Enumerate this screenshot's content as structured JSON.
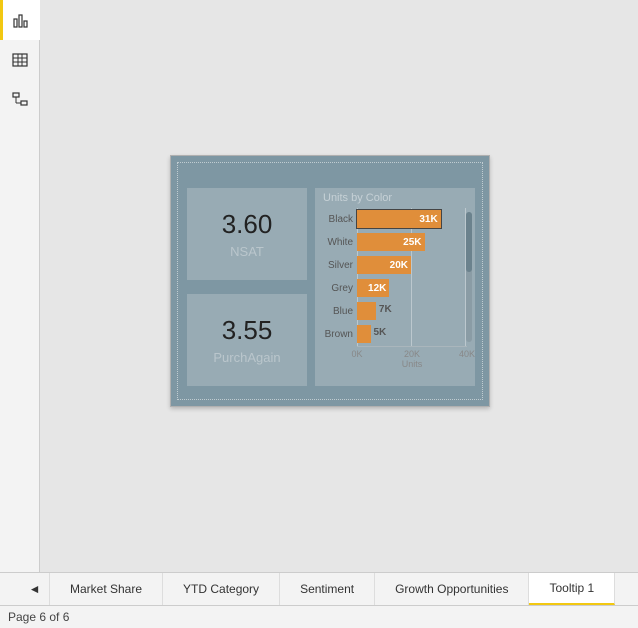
{
  "rail": {
    "report": true,
    "data": false,
    "model": false
  },
  "cards": [
    {
      "value": "3.60",
      "label": "NSAT"
    },
    {
      "value": "3.55",
      "label": "PurchAgain"
    }
  ],
  "chart_data": {
    "type": "bar",
    "title": "Units by Color",
    "xlabel": "Units",
    "categories": [
      "Black",
      "White",
      "Silver",
      "Grey",
      "Blue",
      "Brown"
    ],
    "values": [
      31000,
      25000,
      20000,
      12000,
      7000,
      5000
    ],
    "value_labels": [
      "31K",
      "25K",
      "20K",
      "12K",
      "7K",
      "5K"
    ],
    "xlim": [
      0,
      40000
    ],
    "ticks": [
      0,
      20000,
      40000
    ],
    "tick_labels": [
      "0K",
      "20K",
      "40K"
    ],
    "selected_index": 0
  },
  "tabs": {
    "items": [
      "Market Share",
      "YTD Category",
      "Sentiment",
      "Growth Opportunities",
      "Tooltip 1"
    ],
    "active_index": 4
  },
  "status": "Page 6 of 6"
}
